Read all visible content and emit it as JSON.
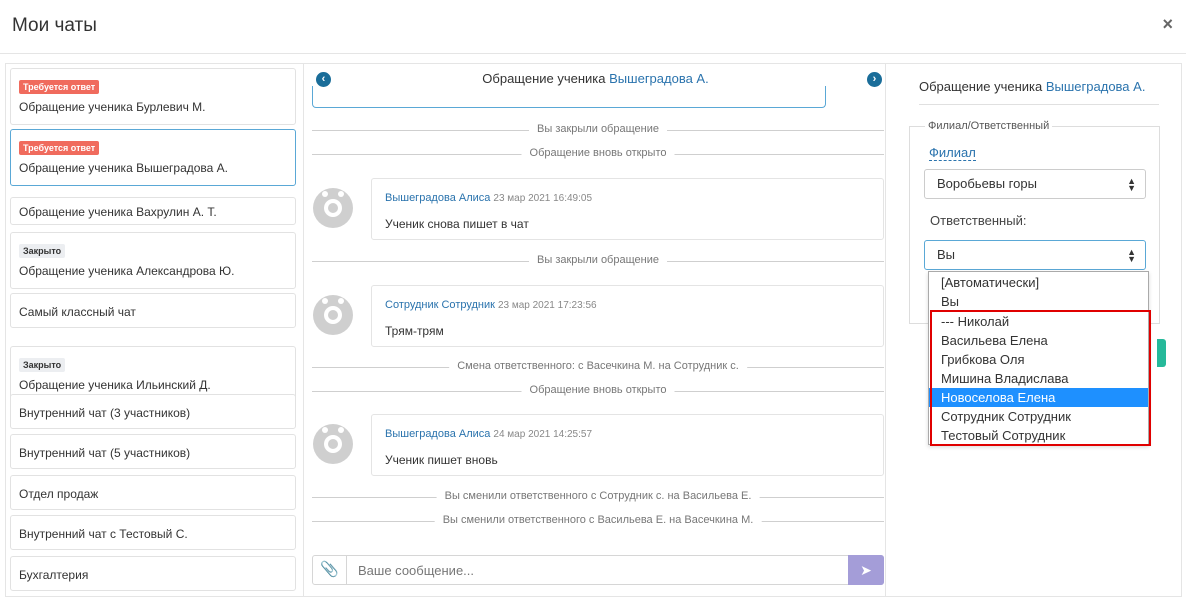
{
  "header": {
    "title": "Мои чаты",
    "close": "×"
  },
  "chats": [
    {
      "badge": "Требуется ответ",
      "badge_color": "red",
      "name": "Обращение ученика Бурлевич М."
    },
    {
      "badge": "Требуется ответ",
      "badge_color": "red",
      "name": "Обращение ученика Вышеградова А.",
      "active": true
    },
    {
      "badge": "",
      "name": "Обращение ученика Вахрулин А. Т."
    },
    {
      "badge": "Закрыто",
      "badge_color": "grey",
      "name": "Обращение ученика Александрова Ю."
    },
    {
      "badge": "",
      "name": "Самый классный чат"
    },
    {
      "badge": "Закрыто",
      "badge_color": "grey",
      "name": "Обращение ученика Ильинский Д."
    },
    {
      "badge": "",
      "name": "Внутренний чат (3 участников)"
    },
    {
      "badge": "",
      "name": "Внутренний чат (5 участников)"
    },
    {
      "badge": "",
      "name": "Отдел продаж"
    },
    {
      "badge": "",
      "name": "Внутренний чат с Тестовый С."
    },
    {
      "badge": "",
      "name": "Бухгалтерия"
    }
  ],
  "conversation": {
    "title_prefix": "Обращение ученика",
    "title_name": "Вышеградова А.",
    "events": [
      {
        "type": "system",
        "text": "Вы закрыли обращение"
      },
      {
        "type": "system",
        "text": "Обращение вновь открыто"
      },
      {
        "type": "message",
        "author": "Вышеградова Алиса",
        "time": "23 мар 2021 16:49:05",
        "text": "Ученик снова пишет в чат"
      },
      {
        "type": "system",
        "text": "Вы закрыли обращение"
      },
      {
        "type": "message",
        "author": "Сотрудник Сотрудник",
        "time": "23 мар 2021 17:23:56",
        "text": "Трям-трям"
      },
      {
        "type": "system",
        "text": "Смена ответственного: с Васечкина М. на Сотрудник с."
      },
      {
        "type": "system",
        "text": "Обращение вновь открыто"
      },
      {
        "type": "message",
        "author": "Вышеградова Алиса",
        "time": "24 мар 2021 14:25:57",
        "text": "Ученик пишет вновь"
      },
      {
        "type": "system",
        "text": "Вы сменили ответственного с Сотрудник с. на Васильева Е."
      },
      {
        "type": "system",
        "text": "Вы сменили ответственного с Васильева Е. на Васечкина М."
      }
    ],
    "composer_placeholder": "Ваше сообщение..."
  },
  "details": {
    "title_prefix": "Обращение ученика",
    "title_name": "Вышеградова А.",
    "fieldset_legend": "Филиал/Ответственный",
    "filial_link": "Филиал",
    "filial_value": "Воробьевы горы",
    "responsible_label": "Ответственный:",
    "responsible_value": "Вы",
    "options": [
      "[Автоматически]",
      "Вы",
      "--- Николай",
      "Васильева Елена",
      "Грибкова Оля",
      "Мишина Владислава",
      "Новоселова Елена",
      "Сотрудник Сотрудник",
      "Тестовый Сотрудник"
    ],
    "highlighted_option": "Новоселова Елена"
  },
  "colors": {
    "accent": "#2a73ad",
    "red_badge": "#f06b5d",
    "highlight": "#1e90ff",
    "send": "#a49dd8",
    "annotation": "#e00000"
  }
}
